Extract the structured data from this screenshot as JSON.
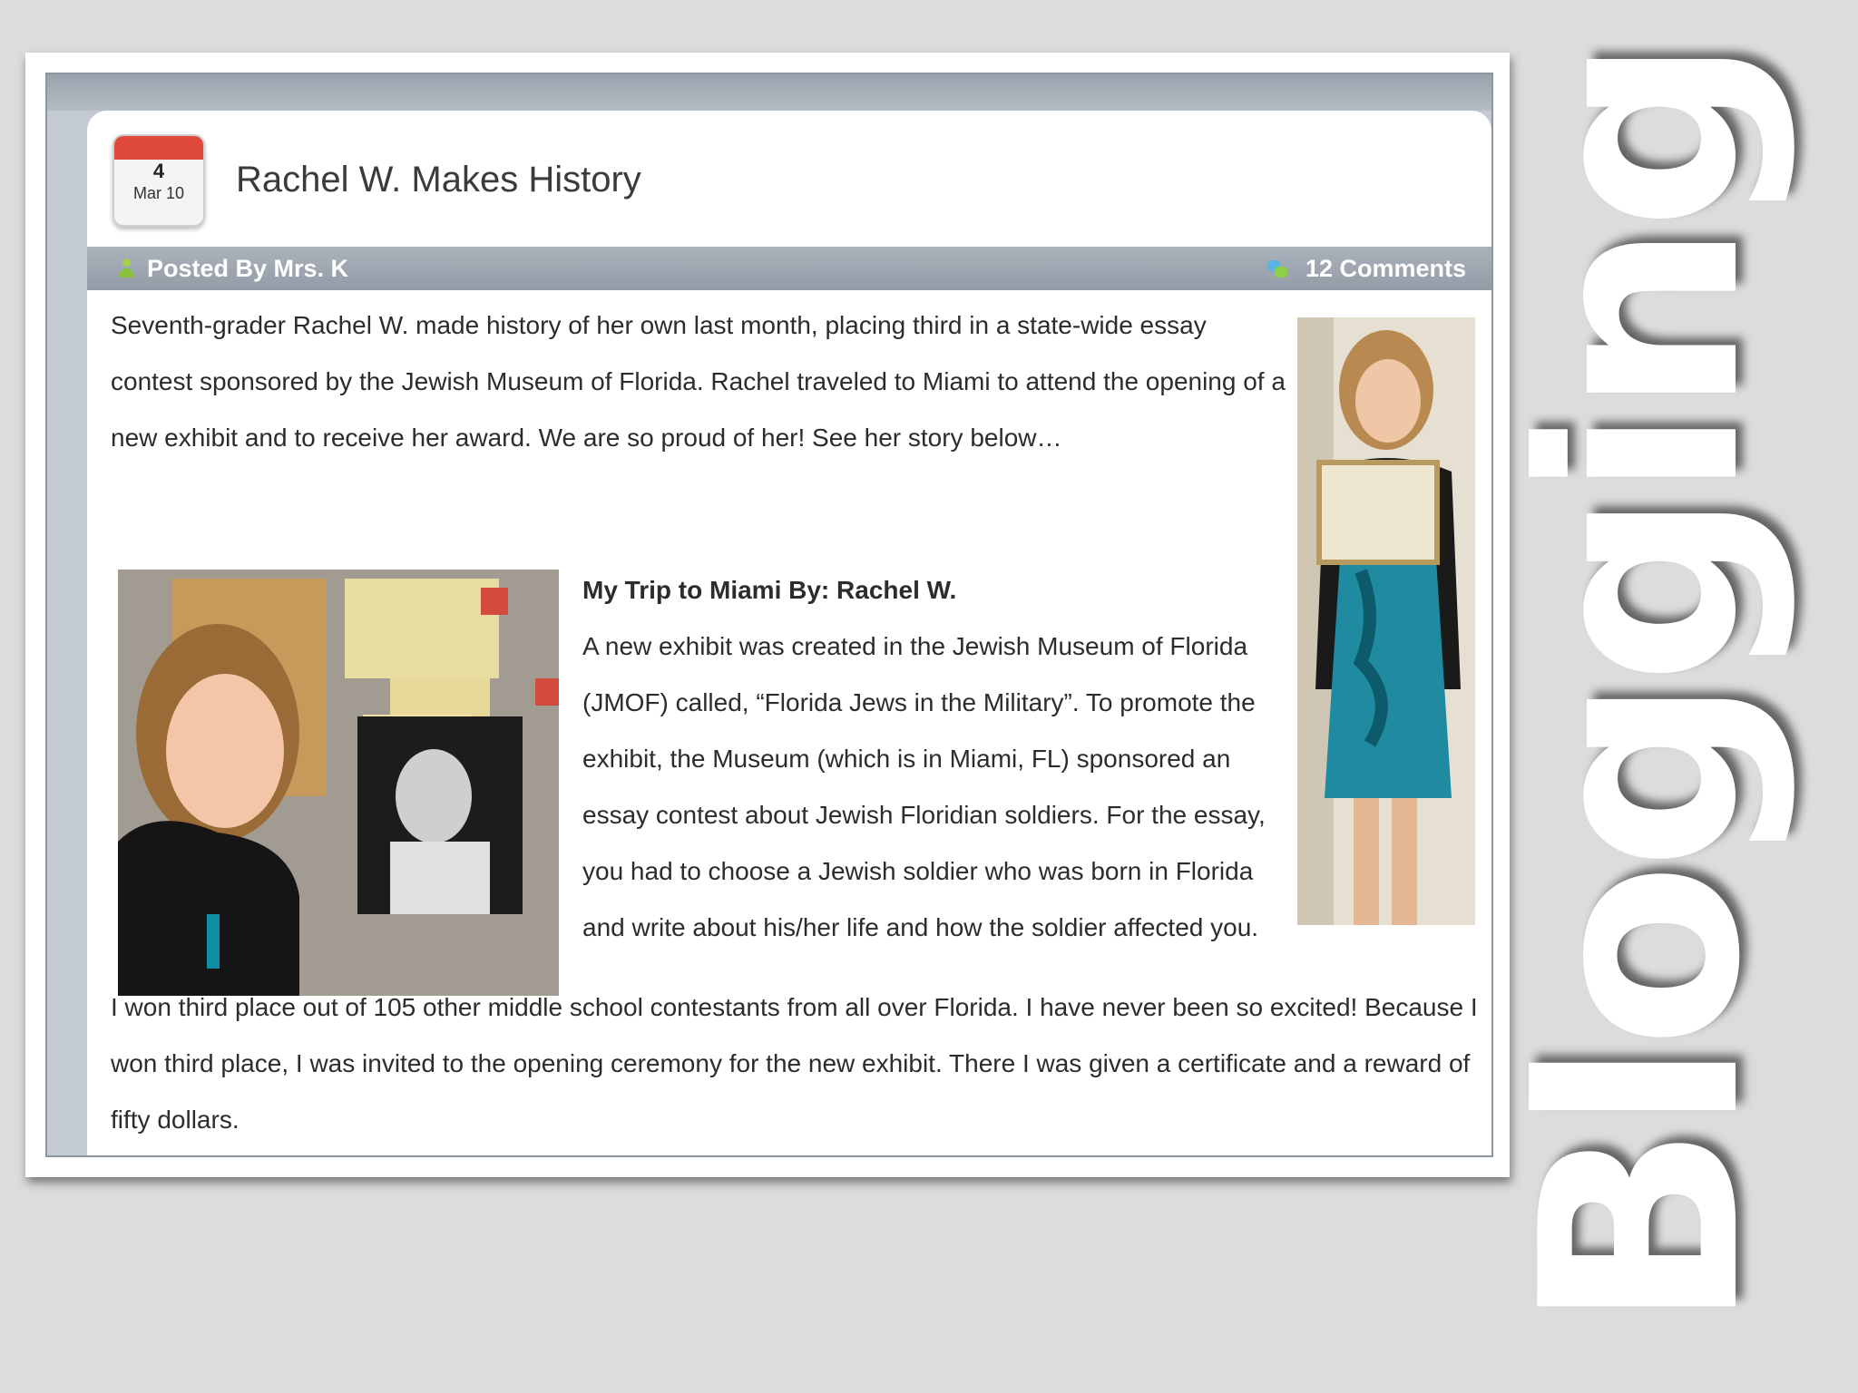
{
  "post": {
    "date_day": "4",
    "date_month": "Mar 10",
    "title": "Rachel W. Makes History",
    "posted_by": "Posted By Mrs. K",
    "comments": "12 Comments",
    "intro": "Seventh-grader Rachel W. made history of her own last month, placing third in a state-wide essay contest sponsored by the Jewish Museum of Florida. Rachel traveled to Miami to attend the opening of a new exhibit and to receive her award. We are so proud of her! See her story below…",
    "story_title": "My Trip to Miami By: Rachel W.",
    "story_text": "A new exhibit was created in the Jewish Museum of Florida (JMOF) called, “Florida Jews in the Military”. To promote the exhibit, the Museum (which is in Miami, FL) sponsored an essay contest about Jewish Floridian soldiers. For the essay, you had to choose a Jewish soldier who was born in Florida and write about his/her life and how the soldier affected you.",
    "closing": "I won third place out of 105 other middle school contestants from all over Florida. I have never been so excited! Because I won third place, I was invited to the opening ceremony for the new exhibit. There I was given a certificate and a reward of fifty dollars."
  },
  "slide": {
    "title": "Blogging"
  },
  "icons": {
    "calendar": "calendar-icon",
    "user": "user-icon",
    "comments": "comment-bubbles-icon"
  },
  "colors": {
    "meta_bar": "#9aa3ad",
    "calendar_red": "#e04a3c",
    "background": "#dcdcde"
  }
}
